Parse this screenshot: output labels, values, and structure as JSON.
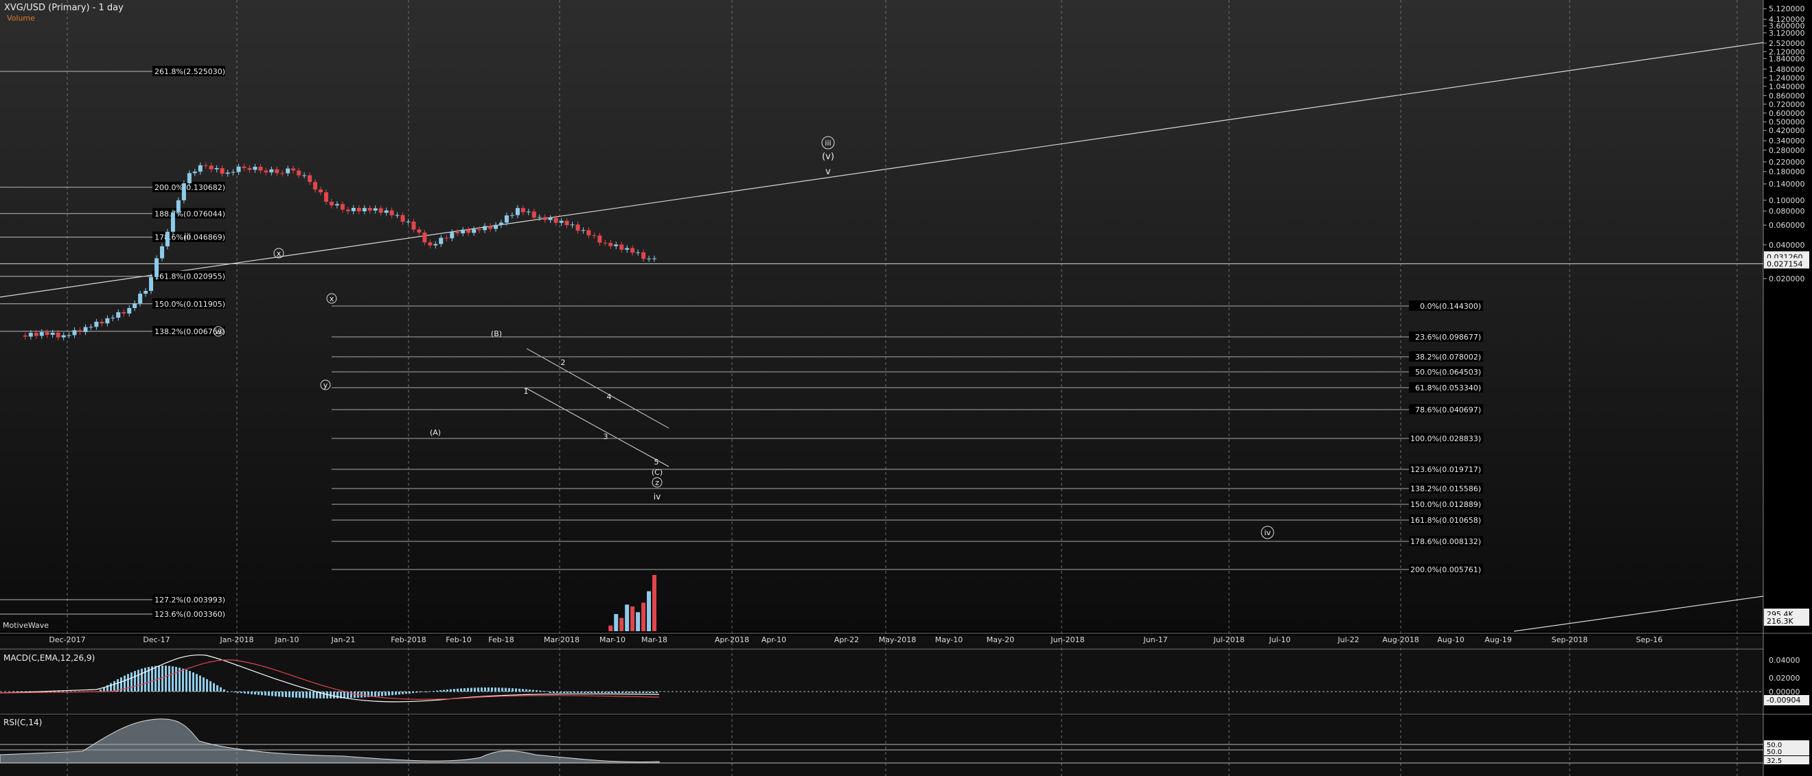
{
  "header": {
    "title": "XVG/USD (Primary) - 1 day",
    "volume_label": "Volume",
    "watermark": "MotiveWave"
  },
  "colors": {
    "background": "#000000",
    "panel_top": "#2c2c2c",
    "up": "#8ecbea",
    "down": "#e0464b",
    "grid": "#6e6e6e",
    "line": "#d8d8d8",
    "orange": "#e07b2c"
  },
  "price_axis": {
    "ticks": [
      "5.120000",
      "4.120000",
      "3.600000",
      "3.120000",
      "2.520000",
      "2.120000",
      "1.840000",
      "1.480000",
      "1.240000",
      "1.040000",
      "0.860000",
      "0.720000",
      "0.600000",
      "0.500000",
      "0.420000",
      "0.340000",
      "0.280000",
      "0.220000",
      "0.180000",
      "0.140000",
      "0.100000",
      "0.080000",
      "0.060000",
      "0.040000",
      "0.020000"
    ],
    "last_price_badge": "0.031260",
    "current_badge": "0.027154",
    "volume_badge_top": "295.4K",
    "volume_badge_bottom": "216.3K"
  },
  "time_axis": {
    "labels": [
      "Dec-2017",
      "Dec-17",
      "Jan-2018",
      "Jan-10",
      "Jan-21",
      "Feb-2018",
      "Feb-10",
      "Feb-18",
      "Mar-2018",
      "Mar-10",
      "Mar-18",
      "Apr-2018",
      "Apr-10",
      "Apr-22",
      "May-2018",
      "May-10",
      "May-20",
      "Jun-2018",
      "Jun-17",
      "Jul-2018",
      "Jul-10",
      "Jul-22",
      "Aug-2018",
      "Aug-10",
      "Aug-19",
      "Sep-2018",
      "Sep-16"
    ]
  },
  "fib_left": [
    "261.8%(2.525030)",
    "200.0%(0.130682)",
    "188.7%(0.076044)",
    "178.6%(0.046869)",
    "161.8%(0.020955)",
    "150.0%(0.011905)",
    "138.2%(0.006763)",
    "127.2%(0.003993)",
    "123.6%(0.003360)"
  ],
  "fib_right": [
    "0.0%(0.144300)",
    "23.6%(0.098677)",
    "38.2%(0.078002)",
    "50.0%(0.064503)",
    "61.8%(0.053340)",
    "78.6%(0.040697)",
    "100.0%(0.028833)",
    "123.6%(0.019717)",
    "138.2%(0.015586)",
    "150.0%(0.012889)",
    "161.8%(0.010658)",
    "178.6%(0.008132)",
    "200.0%(0.005761)"
  ],
  "wave_labels": {
    "iii_small": "iii",
    "x1": "x",
    "w": "w",
    "x2": "x",
    "y": "y",
    "B": "(B)",
    "A": "(A)",
    "n1": "1",
    "n2": "2",
    "n3": "3",
    "n4": "4",
    "n5": "5",
    "C": "(C)",
    "z": "z",
    "iv_small": "iv",
    "iii_big": "iii",
    "v_paren": "(v)",
    "v_small": "v",
    "iv_big": "iv"
  },
  "macd": {
    "title": "MACD(C,EMA,12,26,9)",
    "ticks": [
      "0.04000",
      "0.02000",
      "0.00000"
    ],
    "badge": "-0.00904"
  },
  "rsi": {
    "title": "RSI(C,14)",
    "badge1": "50.0",
    "badge2": "50.0",
    "badge3": "32.5"
  },
  "chart_data": {
    "type": "candlestick",
    "symbol": "XVG/USD",
    "interval": "1 day",
    "y_scale": "log",
    "close_series_approx": {
      "name": "",
      "x": [
        "2017-11-23",
        "2017-11-27",
        "2017-12-01",
        "2017-12-05",
        "2017-12-09",
        "2017-12-13",
        "2017-12-16",
        "2017-12-19",
        "2017-12-21",
        "2017-12-24",
        "2017-12-27",
        "2017-12-31",
        "2018-01-03",
        "2018-01-06",
        "2018-01-09",
        "2018-01-12",
        "2018-01-15",
        "2018-01-18",
        "2018-01-21",
        "2018-01-25",
        "2018-01-29",
        "2018-02-02",
        "2018-02-06",
        "2018-02-10",
        "2018-02-14",
        "2018-02-18",
        "2018-02-22",
        "2018-02-26",
        "2018-03-02",
        "2018-03-06",
        "2018-03-10",
        "2018-03-14",
        "2018-03-18"
      ],
      "values": [
        0.0064,
        0.006,
        0.0071,
        0.0085,
        0.0105,
        0.016,
        0.04,
        0.075,
        0.18,
        0.21,
        0.17,
        0.2,
        0.19,
        0.18,
        0.19,
        0.15,
        0.1,
        0.085,
        0.082,
        0.078,
        0.062,
        0.038,
        0.05,
        0.053,
        0.058,
        0.082,
        0.068,
        0.063,
        0.052,
        0.04,
        0.036,
        0.029,
        0.0312
      ]
    },
    "volume_bars_approx": {
      "x": [
        "2018-03-10",
        "2018-03-11",
        "2018-03-12",
        "2018-03-13",
        "2018-03-14",
        "2018-03-15",
        "2018-03-16",
        "2018-03-17",
        "2018-03-18"
      ],
      "values": [
        30000,
        90000,
        70000,
        140000,
        130000,
        100000,
        150000,
        210000,
        295400
      ]
    },
    "fib_levels_right": [
      0.1443,
      0.098677,
      0.078002,
      0.064503,
      0.05334,
      0.040697,
      0.028833,
      0.019717,
      0.015586,
      0.012889,
      0.010658,
      0.008132,
      0.005761
    ],
    "fib_levels_left": [
      2.52503,
      0.130682,
      0.076044,
      0.046869,
      0.020955,
      0.011905,
      0.006763,
      0.003993,
      0.00336
    ],
    "last_price": 0.03126,
    "crosshair_price": 0.027154
  }
}
